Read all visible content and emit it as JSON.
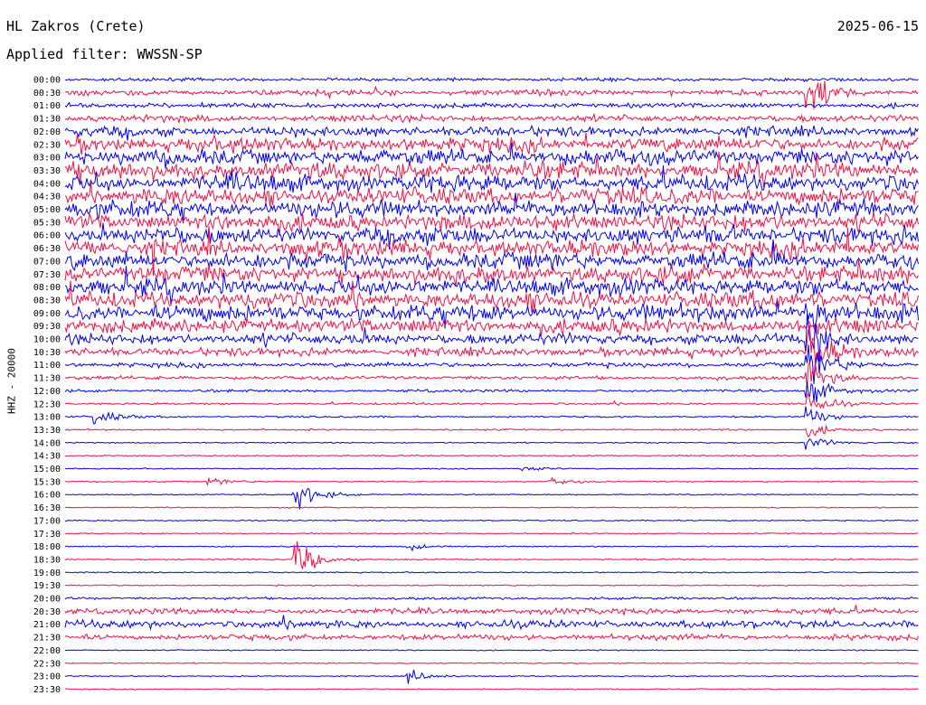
{
  "header": {
    "station": "HL Zakros (Crete)",
    "date": "2025-06-15",
    "filter_label": "Applied filter: WWSSN-SP",
    "channel": "HHZ - 20000"
  },
  "colors": {
    "even_trace": "#0000ee",
    "odd_trace": "#ee1144",
    "background": "#ffffff"
  },
  "chart_data": {
    "type": "line",
    "title": "HL Zakros (Crete)",
    "subtitle": "Applied filter: WWSSN-SP",
    "ylabel": "HHZ - 20000",
    "xlabel": "",
    "grid": false,
    "legend": "none",
    "row_times": [
      "00:00",
      "00:30",
      "01:00",
      "01:30",
      "02:00",
      "02:30",
      "03:00",
      "03:30",
      "04:00",
      "04:30",
      "05:00",
      "05:30",
      "06:00",
      "06:30",
      "07:00",
      "07:30",
      "08:00",
      "08:30",
      "09:00",
      "09:30",
      "10:00",
      "10:30",
      "11:00",
      "11:30",
      "12:00",
      "12:30",
      "13:00",
      "13:30",
      "14:00",
      "14:30",
      "15:00",
      "15:30",
      "16:00",
      "16:30",
      "17:00",
      "17:30",
      "18:00",
      "18:30",
      "19:00",
      "19:30",
      "20:00",
      "20:30",
      "21:00",
      "21:30",
      "22:00",
      "22:30",
      "23:00",
      "23:30"
    ],
    "row_minutes": 30,
    "series_colors_alternate": [
      "blue",
      "red"
    ],
    "noise_level": [
      0.2,
      0.35,
      0.3,
      0.4,
      0.6,
      0.85,
      0.95,
      1.0,
      1.0,
      1.0,
      1.0,
      1.0,
      1.0,
      1.0,
      1.0,
      1.0,
      1.0,
      1.0,
      1.0,
      0.85,
      0.65,
      0.5,
      0.28,
      0.22,
      0.16,
      0.13,
      0.11,
      0.1,
      0.07,
      0.06,
      0.05,
      0.07,
      0.06,
      0.06,
      0.06,
      0.07,
      0.07,
      0.09,
      0.07,
      0.08,
      0.15,
      0.35,
      0.45,
      0.35,
      0.05,
      0.04,
      0.06,
      0.05
    ],
    "events": [
      {
        "time": "00:30",
        "minute": 26,
        "amplitude": 4.0
      },
      {
        "time": "09:00",
        "minute": 26,
        "amplitude": 2.5
      },
      {
        "time": "10:00",
        "minute": 26,
        "amplitude": 4.0
      },
      {
        "time": "10:30",
        "minute": 26,
        "amplitude": 5.0
      },
      {
        "time": "11:00",
        "minute": 26,
        "amplitude": 3.5
      },
      {
        "time": "11:30",
        "minute": 26,
        "amplitude": 3.0
      },
      {
        "time": "12:00",
        "minute": 26,
        "amplitude": 2.5
      },
      {
        "time": "12:30",
        "minute": 26,
        "amplitude": 2.0
      },
      {
        "time": "13:00",
        "minute": 26,
        "amplitude": 1.5
      },
      {
        "time": "13:30",
        "minute": 26,
        "amplitude": 1.2
      },
      {
        "time": "14:00",
        "minute": 26,
        "amplitude": 1.0
      },
      {
        "time": "15:30",
        "minute": 5,
        "amplitude": 0.6
      },
      {
        "time": "15:30",
        "minute": 17,
        "amplitude": 0.6
      },
      {
        "time": "16:00",
        "minute": 8,
        "amplitude": 2.5
      },
      {
        "time": "15:00",
        "minute": 16,
        "amplitude": 0.6
      },
      {
        "time": "18:00",
        "minute": 12,
        "amplitude": 0.8
      },
      {
        "time": "18:30",
        "minute": 8,
        "amplitude": 3.2
      },
      {
        "time": "13:00",
        "minute": 1,
        "amplitude": 1.2
      },
      {
        "time": "23:00",
        "minute": 12,
        "amplitude": 1.0
      }
    ]
  }
}
